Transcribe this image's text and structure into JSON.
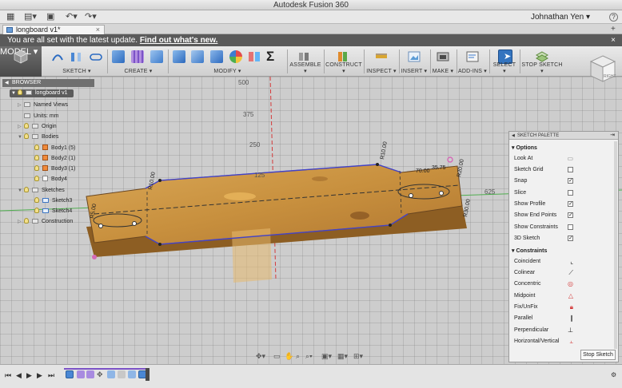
{
  "window": {
    "title": "Autodesk Fusion 360"
  },
  "appbar": {
    "user": "Johnathan Yen",
    "user_caret": "▾",
    "help": "?"
  },
  "tab": {
    "name": "longboard v1*",
    "close": "×"
  },
  "notice": {
    "text": "You are all set with the latest update.",
    "link": "Find out what's new.",
    "close": "×"
  },
  "toolbar": {
    "workspace": "MODEL ▾",
    "groups": {
      "sketch": "SKETCH ▾",
      "create": "CREATE ▾",
      "modify": "MODIFY ▾",
      "assemble": "ASSEMBLE ▾",
      "construct": "CONSTRUCT ▾",
      "inspect": "INSPECT ▾",
      "insert": "INSERT ▾",
      "make": "MAKE ▾",
      "addins": "ADD-INS ▾",
      "select": "SELECT ▾",
      "stop_sketch": "STOP SKETCH ▾"
    },
    "sigma": "Σ"
  },
  "viewcube": {
    "face": "RIGHT"
  },
  "browser": {
    "header": "BROWSER",
    "root": "longboard v1",
    "items": {
      "named_views": "Named Views",
      "units": "Units: mm",
      "origin": "Origin",
      "bodies": "Bodies",
      "body1": "Body1 (5)",
      "body2": "Body2 (1)",
      "body3": "Body3 (1)",
      "body4": "Body4",
      "sketches": "Sketches",
      "sketch3": "Sketch3",
      "sketch4": "Sketch4",
      "construction": "Construction"
    }
  },
  "axis_labels": {
    "a500": "500",
    "a375": "375",
    "a250": "250",
    "a125": "125",
    "a625": "625"
  },
  "dimensions": {
    "r10": "R10.00",
    "r5": "R5.00",
    "r20": "R20.00",
    "r30": "R30.00",
    "d70": "70.00",
    "d35": "35.75"
  },
  "palette": {
    "header": "SKETCH PALETTE",
    "options_title": "Options",
    "options": {
      "look_at": "Look At",
      "sketch_grid": "Sketch Grid",
      "snap": "Snap",
      "slice": "Slice",
      "show_profile": "Show Profile",
      "show_end_points": "Show End Points",
      "show_constraints": "Show Constraints",
      "sketch_3d": "3D Sketch"
    },
    "constraints_title": "Constraints",
    "constraints": {
      "coincident": "Coincident",
      "colinear": "Colinear",
      "concentric": "Concentric",
      "midpoint": "Midpoint",
      "fix": "Fix/UnFix",
      "parallel": "Parallel",
      "perpendicular": "Perpendicular",
      "horizontal": "Horizontal/Vertical"
    },
    "check": "✓",
    "stop_button": "Stop Sketch"
  },
  "timeline": {
    "first": "⏮",
    "prev": "◀",
    "play": "▶",
    "next": "▶",
    "last": "⏭"
  }
}
